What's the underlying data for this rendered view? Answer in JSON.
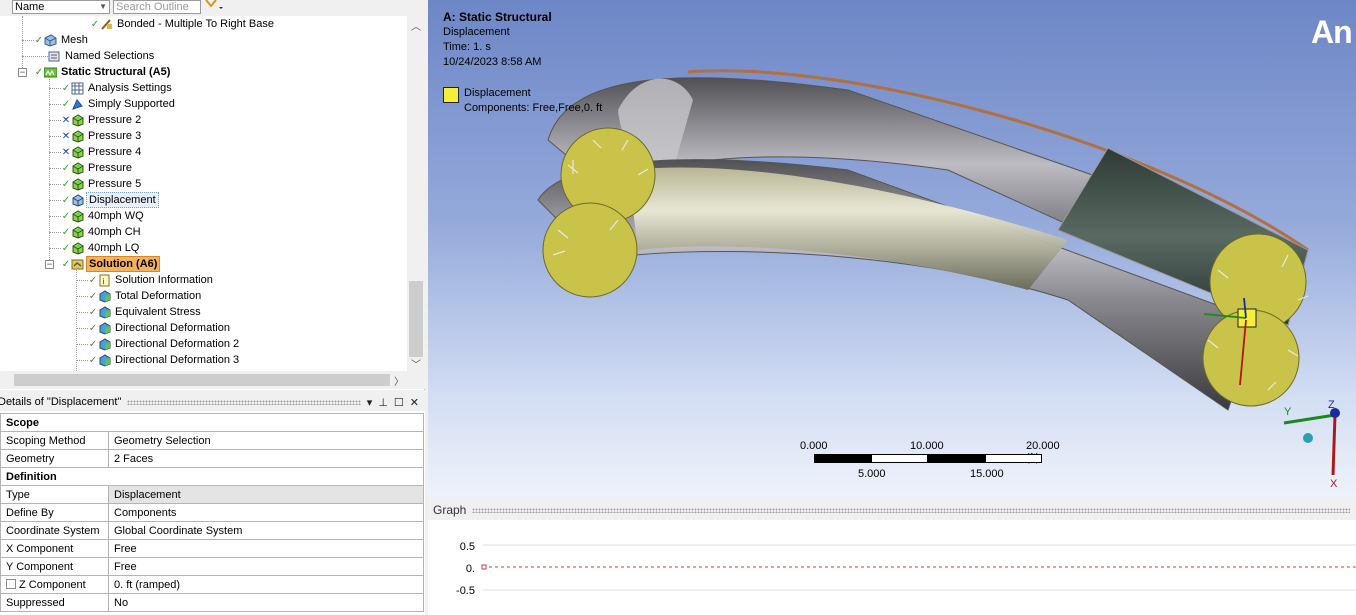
{
  "outline": {
    "name_filter": "Name",
    "search_placeholder": "Search Outline",
    "items": [
      {
        "label": "Bonded - Multiple To Right Base"
      },
      {
        "label": "Mesh"
      },
      {
        "label": "Named Selections"
      },
      {
        "label": "Static Structural (A5)"
      },
      {
        "label": "Analysis Settings"
      },
      {
        "label": "Simply Supported"
      },
      {
        "label": "Pressure 2"
      },
      {
        "label": "Pressure 3"
      },
      {
        "label": "Pressure 4"
      },
      {
        "label": "Pressure"
      },
      {
        "label": "Pressure 5"
      },
      {
        "label": "Displacement"
      },
      {
        "label": "40mph WQ"
      },
      {
        "label": "40mph CH"
      },
      {
        "label": "40mph LQ"
      },
      {
        "label": "Solution (A6)"
      },
      {
        "label": "Solution Information"
      },
      {
        "label": "Total Deformation"
      },
      {
        "label": "Equivalent Stress"
      },
      {
        "label": "Directional Deformation"
      },
      {
        "label": "Directional Deformation 2"
      },
      {
        "label": "Directional Deformation 3"
      }
    ]
  },
  "details": {
    "title": "Details of \"Displacement\"",
    "rows": [
      {
        "key": "Scope",
        "header": true
      },
      {
        "key": "Scoping Method",
        "value": "Geometry Selection"
      },
      {
        "key": "Geometry",
        "value": "2 Faces"
      },
      {
        "key": "Definition",
        "header": true
      },
      {
        "key": "Type",
        "value": "Displacement"
      },
      {
        "key": "Define By",
        "value": "Components"
      },
      {
        "key": "Coordinate System",
        "value": "Global Coordinate System"
      },
      {
        "key": "X Component",
        "value": "Free"
      },
      {
        "key": "Y Component",
        "value": "Free"
      },
      {
        "key": "Z Component",
        "value": "0. ft  (ramped)"
      },
      {
        "key": "Suppressed",
        "value": "No"
      }
    ]
  },
  "viewport": {
    "title": "A: Static Structural",
    "subtitle": "Displacement",
    "time": "Time: 1. s",
    "date": "10/24/2023 8:58 AM",
    "legend_label": "Displacement",
    "legend_components": "Components: Free,Free,0. ft",
    "brand": "An",
    "scale": {
      "top_labels": [
        "0.000",
        "10.000",
        "20.000 (ft)"
      ],
      "bottom_labels": [
        "5.000",
        "15.000"
      ]
    },
    "triad": {
      "x": "X",
      "y": "Y",
      "z": "Z"
    },
    "colors": {
      "highlight": "#f5ef3a",
      "pipe": "#6e6e72",
      "selected_face": "#c9c780"
    }
  },
  "graph": {
    "title": "Graph",
    "yticks": [
      "0.5",
      "0.",
      "-0.5"
    ]
  }
}
